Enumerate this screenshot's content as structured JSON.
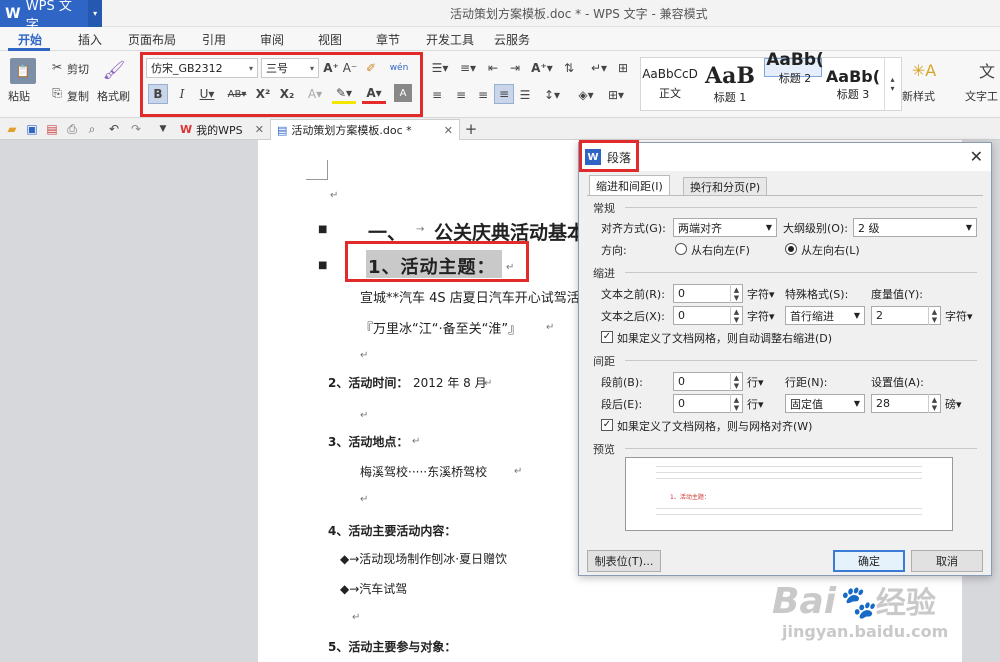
{
  "app": {
    "name": "WPS 文字",
    "window_title": "活动策划方案模板.doc * - WPS 文字 - 兼容模式"
  },
  "menu": [
    "开始",
    "插入",
    "页面布局",
    "引用",
    "审阅",
    "视图",
    "章节",
    "开发工具",
    "云服务"
  ],
  "ribbon": {
    "paste": "粘贴",
    "cut": "剪切",
    "copy": "复制",
    "format_painter": "格式刷",
    "font_name": "仿宋_GB2312",
    "font_size": "三号",
    "styles": [
      {
        "preview": "AaBbCcD",
        "name": "正文"
      },
      {
        "preview": "AaB",
        "name": "标题 1"
      },
      {
        "preview": "AaBb(",
        "name": "标题 2"
      },
      {
        "preview": "AaBb(",
        "name": "标题 3"
      }
    ],
    "new_style": "新样式",
    "text_tools": "文字工"
  },
  "tabs": [
    {
      "label": "我的WPS"
    },
    {
      "label": "活动策划方案模板.doc *"
    }
  ],
  "document": {
    "heading1_num": "一、",
    "heading1_text": "公关庆典活动基本",
    "heading2": "1、活动主题：",
    "line1": "宣城**汽车 4S 店夏日汽车开心试驾活",
    "line2": "『万里冰“江“·备至关“淮”』",
    "time_label": "2、活动时间：",
    "time_value": "2012 年 8 月",
    "place_label": "3、活动地点：",
    "place_value": "梅溪驾校·····东溪桥驾校",
    "content_label": "4、活动主要活动内容：",
    "bullet1": "◆→活动现场制作刨冰·夏日赠饮",
    "bullet2": "◆→汽车试驾",
    "audience_label": "5、活动主要参与对象："
  },
  "dialog": {
    "title": "段落",
    "tab_indent": "缩进和间距(I)",
    "tab_breaks": "换行和分页(P)",
    "general": "常规",
    "align_label": "对齐方式(G):",
    "align_value": "两端对齐",
    "outline_label": "大纲级别(O):",
    "outline_value": "2 级",
    "direction_label": "方向:",
    "rtl": "从右向左(F)",
    "ltr": "从左向右(L)",
    "indent": "缩进",
    "before_text_label": "文本之前(R):",
    "before_text_value": "0",
    "after_text_label": "文本之后(X):",
    "after_text_value": "0",
    "unit_char": "字符▾",
    "special_label": "特殊格式(S):",
    "special_value": "首行缩进",
    "measure_label": "度量值(Y):",
    "measure_value": "2",
    "auto_indent": "如果定义了文档网格，则自动调整右缩进(D)",
    "spacing": "间距",
    "before_label": "段前(B):",
    "before_value": "0",
    "after_label": "段后(E):",
    "after_value": "0",
    "unit_line": "行▾",
    "line_spacing_label": "行距(N):",
    "line_spacing_value": "固定值",
    "set_value_label": "设置值(A):",
    "set_value": "28",
    "unit_pound": "磅▾",
    "snap_grid": "如果定义了文档网格，则与网格对齐(W)",
    "preview": "预览",
    "preview_sample": "1、活动主题：",
    "tabs_button": "制表位(T)...",
    "ok": "确定",
    "cancel": "取消"
  },
  "watermark": {
    "brand": "Bai",
    "brand2": "经验",
    "url": "jingyan.baidu.com"
  },
  "colors": {
    "accent": "#2f66c6",
    "highlight_box": "#e12b2b"
  }
}
